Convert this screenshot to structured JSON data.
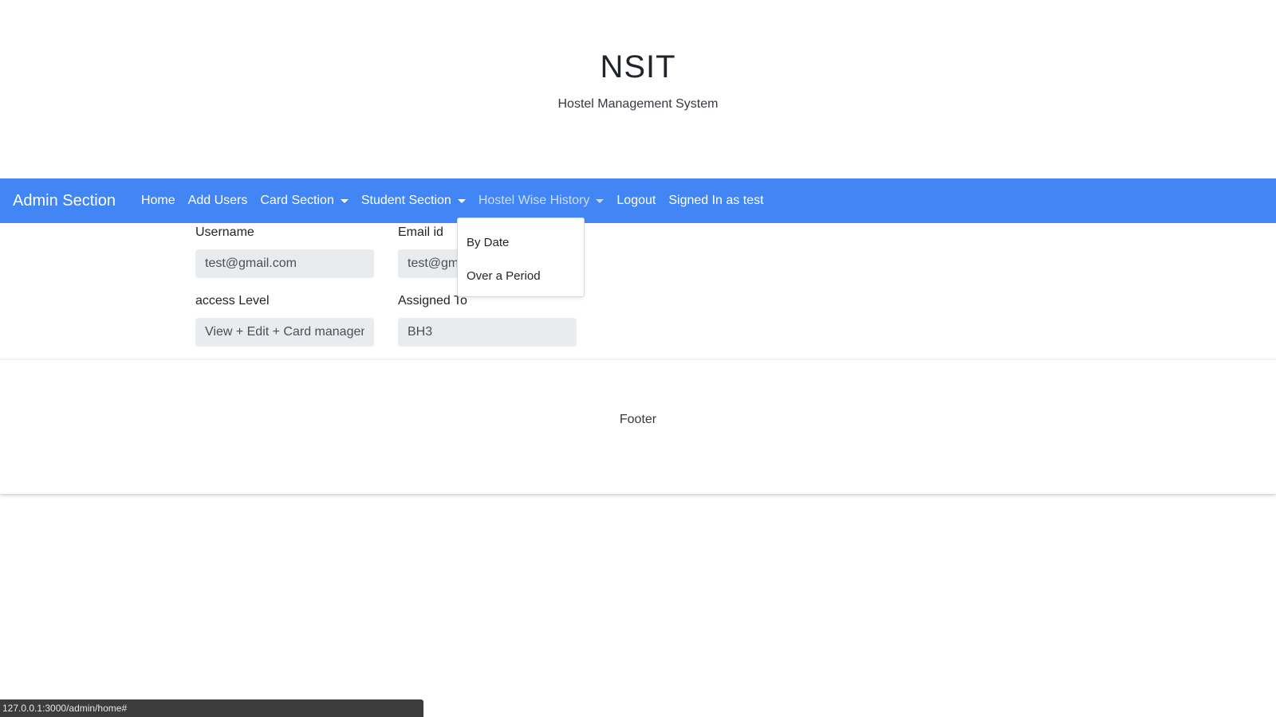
{
  "header": {
    "title": "NSIT",
    "subtitle": "Hostel Management System"
  },
  "navbar": {
    "brand": "Admin Section",
    "links": [
      {
        "label": "Home"
      },
      {
        "label": "Add Users"
      },
      {
        "label": "Card Section"
      },
      {
        "label": "Student Section"
      },
      {
        "label": "Hostel Wise History"
      },
      {
        "label": "Logout"
      },
      {
        "label": "Signed In as test"
      }
    ],
    "color": "#4285f4"
  },
  "dropdown": {
    "items": [
      {
        "label": "By Date"
      },
      {
        "label": "Over a Period"
      }
    ]
  },
  "form": {
    "username_label": "Username",
    "username_value": "test@gmail.com",
    "email_label": "Email id",
    "email_value": "test@gmail.com",
    "access_label": "access Level",
    "access_value": "View + Edit + Card management",
    "assigned_label": "Assigned To",
    "assigned_value": "BH3"
  },
  "footer": {
    "text": "Footer"
  },
  "statusbar": {
    "url": "127.0.0.1:3000/admin/home#"
  }
}
